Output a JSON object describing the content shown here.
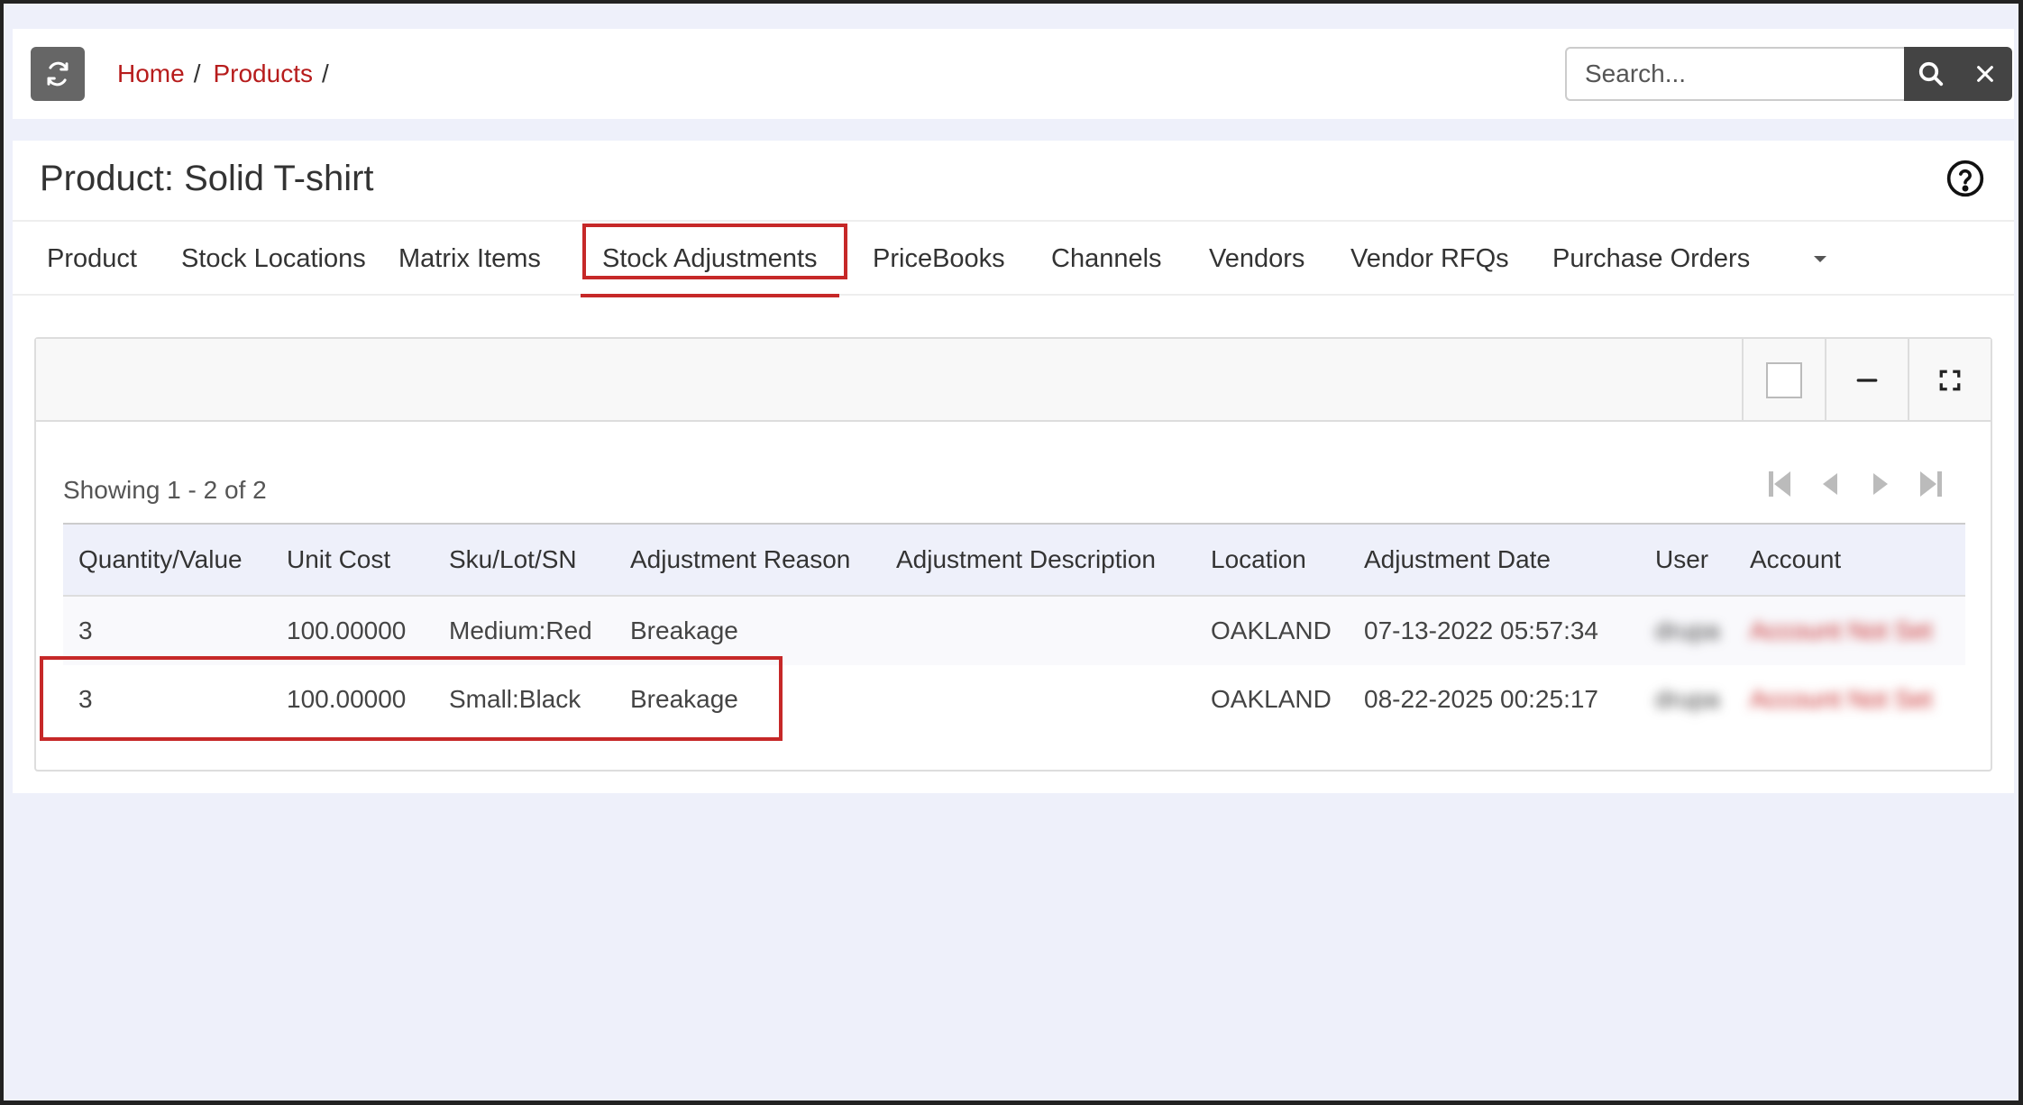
{
  "breadcrumb": {
    "items": [
      "Home",
      "Products"
    ],
    "separator": "/"
  },
  "search": {
    "placeholder": "Search..."
  },
  "page": {
    "title": "Product: Solid T-shirt"
  },
  "tabs": [
    {
      "label": "Product"
    },
    {
      "label": "Stock Locations"
    },
    {
      "label": "Matrix Items"
    },
    {
      "label": "Stock Adjustments",
      "active": true
    },
    {
      "label": "PriceBooks"
    },
    {
      "label": "Channels"
    },
    {
      "label": "Vendors"
    },
    {
      "label": "Vendor RFQs"
    },
    {
      "label": "Purchase Orders"
    }
  ],
  "grid": {
    "showing": "Showing 1 - 2 of 2",
    "columns": [
      "Quantity/Value",
      "Unit Cost",
      "Sku/Lot/SN",
      "Adjustment Reason",
      "Adjustment Description",
      "Location",
      "Adjustment Date",
      "User",
      "Account"
    ],
    "rows": [
      [
        "3",
        "100.00000",
        "Medium:Red",
        "Breakage",
        "",
        "OAKLAND",
        "07-13-2022 05:57:34",
        "drupa",
        "Account Not Set"
      ],
      [
        "3",
        "100.00000",
        "Small:Black",
        "Breakage",
        "",
        "OAKLAND",
        "08-22-2025 00:25:17",
        "drupa",
        "Account Not Set"
      ]
    ]
  },
  "colors": {
    "accent": "#c62828",
    "link": "#b71c1c",
    "background": "#eef0fa",
    "button_dark": "#444444"
  },
  "icons": {
    "refresh": "refresh-icon",
    "search": "search-icon",
    "clear": "close-icon",
    "help": "help-circle-icon",
    "more_tabs": "caret-down-icon",
    "minimize": "minus-icon",
    "fullscreen": "expand-icon",
    "pager": [
      "first-page-icon",
      "prev-page-icon",
      "next-page-icon",
      "last-page-icon"
    ]
  }
}
